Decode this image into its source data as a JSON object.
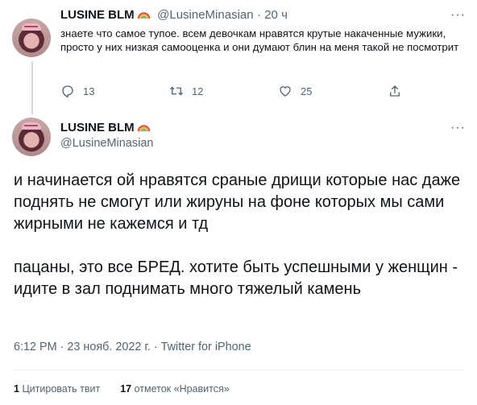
{
  "reply_tweet": {
    "display_name": "LUSINE BLM",
    "handle": "@LusineMinasian",
    "time": "20 ч",
    "text": "знаете что самое тупое. всем девочкам нравятся крутые накаченные мужики, просто у них низкая самооценка и они думают блин на меня такой не посмотрит",
    "actions": {
      "replies": "13",
      "retweets": "12",
      "likes": "25"
    }
  },
  "main_tweet": {
    "display_name": "LUSINE BLM",
    "handle": "@LusineMinasian",
    "paragraph1": "и начинается ой нравятся сраные дрищи которые нас даже поднять не смогут или жируны на фоне которых мы сами жирными не кажемся и тд",
    "paragraph2": "пацаны, это все БРЕД. хотите быть успешными у женщин - идите в зал поднимать много тяжелый камень",
    "timestamp": "6:12 PM · 23 нояб. 2022 г. · Twitter for iPhone",
    "stats": {
      "quotes_count": "1",
      "quotes_label": "Цитировать твит",
      "likes_count": "17",
      "likes_label": "отметок «Нравится»"
    }
  },
  "icons": [
    "rainbow-emoji-icon",
    "more-icon",
    "reply-icon",
    "retweet-icon",
    "like-icon",
    "share-icon"
  ]
}
